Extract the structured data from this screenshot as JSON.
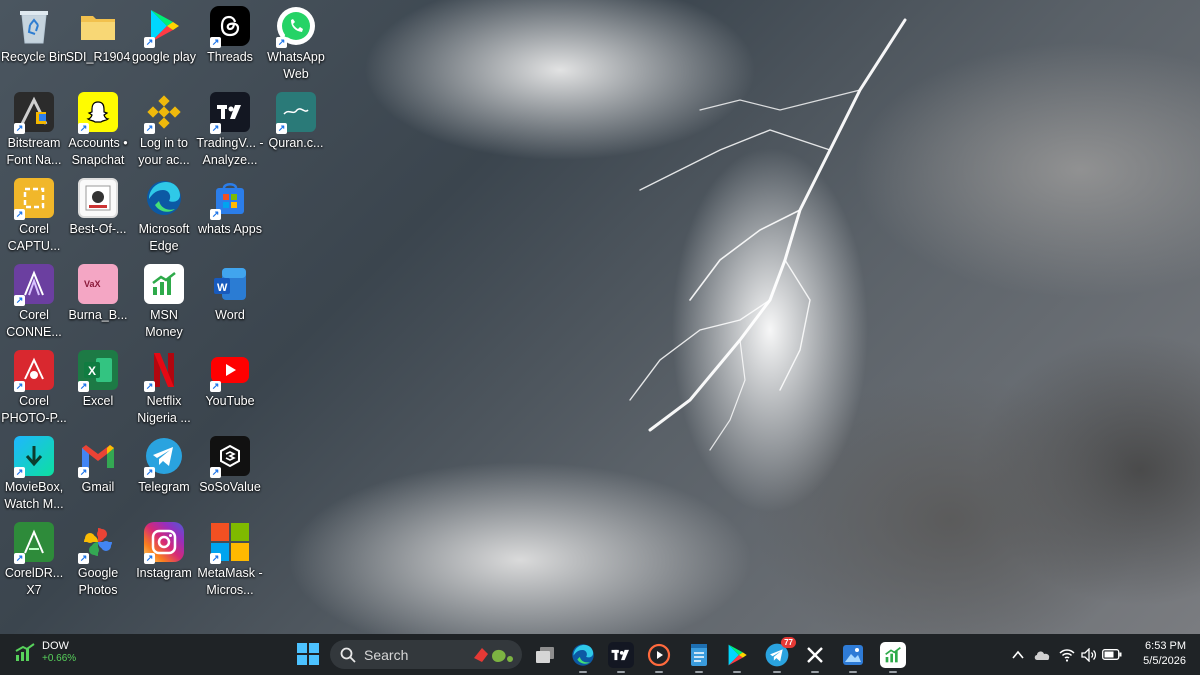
{
  "desktop": {
    "icons": [
      {
        "label": "Recycle Bin",
        "icon": "recycle-bin-icon"
      },
      {
        "label": "SDI_R1904",
        "icon": "folder-icon"
      },
      {
        "label": "google play",
        "icon": "google-play-icon"
      },
      {
        "label": "Threads",
        "icon": "threads-icon"
      },
      {
        "label": "WhatsApp Web",
        "icon": "whatsapp-icon"
      },
      {
        "label": "Bitstream Font Na...",
        "icon": "bitstream-font-icon"
      },
      {
        "label": "Accounts • Snapchat",
        "icon": "snapchat-icon"
      },
      {
        "label": "Log in to your ac...",
        "icon": "binance-icon"
      },
      {
        "label": "TradingV... - Analyze...",
        "icon": "tradingview-icon"
      },
      {
        "label": "Quran.c...",
        "icon": "quran-icon"
      },
      {
        "label": "Corel CAPTU...",
        "icon": "corel-capture-icon"
      },
      {
        "label": "Best-Of-...",
        "icon": "image-file-icon"
      },
      {
        "label": "Microsoft Edge",
        "icon": "edge-icon"
      },
      {
        "label": "whats Apps",
        "icon": "store-icon"
      },
      {
        "label": "Corel CONNE...",
        "icon": "corel-connect-icon"
      },
      {
        "label": "Burna_B...",
        "icon": "image-file-icon"
      },
      {
        "label": "MSN Money",
        "icon": "msn-money-icon"
      },
      {
        "label": "Word",
        "icon": "word-icon"
      },
      {
        "label": "Corel PHOTO-P...",
        "icon": "corel-photo-paint-icon"
      },
      {
        "label": "Excel",
        "icon": "excel-icon"
      },
      {
        "label": "Netflix Nigeria ...",
        "icon": "netflix-icon"
      },
      {
        "label": "YouTube",
        "icon": "youtube-icon"
      },
      {
        "label": "MovieBox, Watch M...",
        "icon": "moviebox-icon"
      },
      {
        "label": "Gmail",
        "icon": "gmail-icon"
      },
      {
        "label": "Telegram",
        "icon": "telegram-icon"
      },
      {
        "label": "SoSoValue",
        "icon": "sosovalue-icon"
      },
      {
        "label": "CorelDR... X7",
        "icon": "coreldraw-icon"
      },
      {
        "label": "Google Photos",
        "icon": "google-photos-icon"
      },
      {
        "label": "Instagram",
        "icon": "instagram-icon"
      },
      {
        "label": "MetaMask - Micros...",
        "icon": "metamask-icon"
      }
    ]
  },
  "taskbar": {
    "widget": {
      "name": "DOW",
      "change": "+0.66%"
    },
    "search_placeholder": "Search",
    "telegram_badge": "77",
    "clock": {
      "time": "6:53 PM",
      "date": "5/5/2026"
    }
  },
  "colors": {
    "taskbar_bg": "#1f2326",
    "accent": "#57d15b"
  }
}
